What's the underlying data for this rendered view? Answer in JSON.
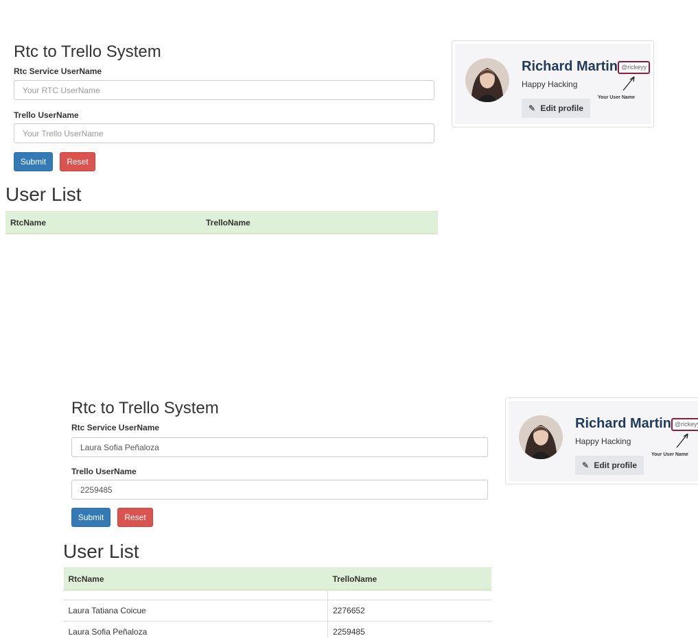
{
  "colors": {
    "submit": "#337ab7",
    "reset": "#d9534f",
    "table_header": "#dff0d8",
    "profile_name": "#1f3a5b",
    "handle_border": "#8b1c3c"
  },
  "top": {
    "form": {
      "title": "Rtc to Trello System",
      "rtc_label": "Rtc Service UserName",
      "rtc_placeholder": "Your RTC UserName",
      "rtc_value": "",
      "trello_label": "Trello UserName",
      "trello_placeholder": "Your Trello UserName",
      "trello_value": "",
      "submit_label": "Submit",
      "reset_label": "Reset"
    },
    "list": {
      "title": "User List",
      "columns": [
        "RtcName",
        "TrelloName"
      ],
      "rows": []
    },
    "profile": {
      "name": "Richard Martin",
      "handle": "@rickeyy",
      "tagline": "Happy Hacking",
      "edit_label": "Edit profile",
      "annotation": "Your User Name",
      "edit_icon": "pencil-icon"
    }
  },
  "bottom": {
    "form": {
      "title": "Rtc to Trello System",
      "rtc_label": "Rtc Service UserName",
      "rtc_placeholder": "Your RTC UserName",
      "rtc_value": "Laura Sofia Peñaloza",
      "trello_label": "Trello UserName",
      "trello_placeholder": "Your Trello UserName",
      "trello_value": "2259485",
      "submit_label": "Submit",
      "reset_label": "Reset"
    },
    "list": {
      "title": "User List",
      "columns": [
        "RtcName",
        "TrelloName"
      ],
      "rows": [
        [
          "",
          ""
        ],
        [
          "Laura Tatiana Coicue",
          "2276652"
        ],
        [
          "Laura Sofia Peñaloza",
          "2259485"
        ]
      ]
    },
    "profile": {
      "name": "Richard Martin",
      "handle": "@rickeyy",
      "tagline": "Happy Hacking",
      "edit_label": "Edit profile",
      "annotation": "Your User Name",
      "edit_icon": "pencil-icon"
    }
  }
}
